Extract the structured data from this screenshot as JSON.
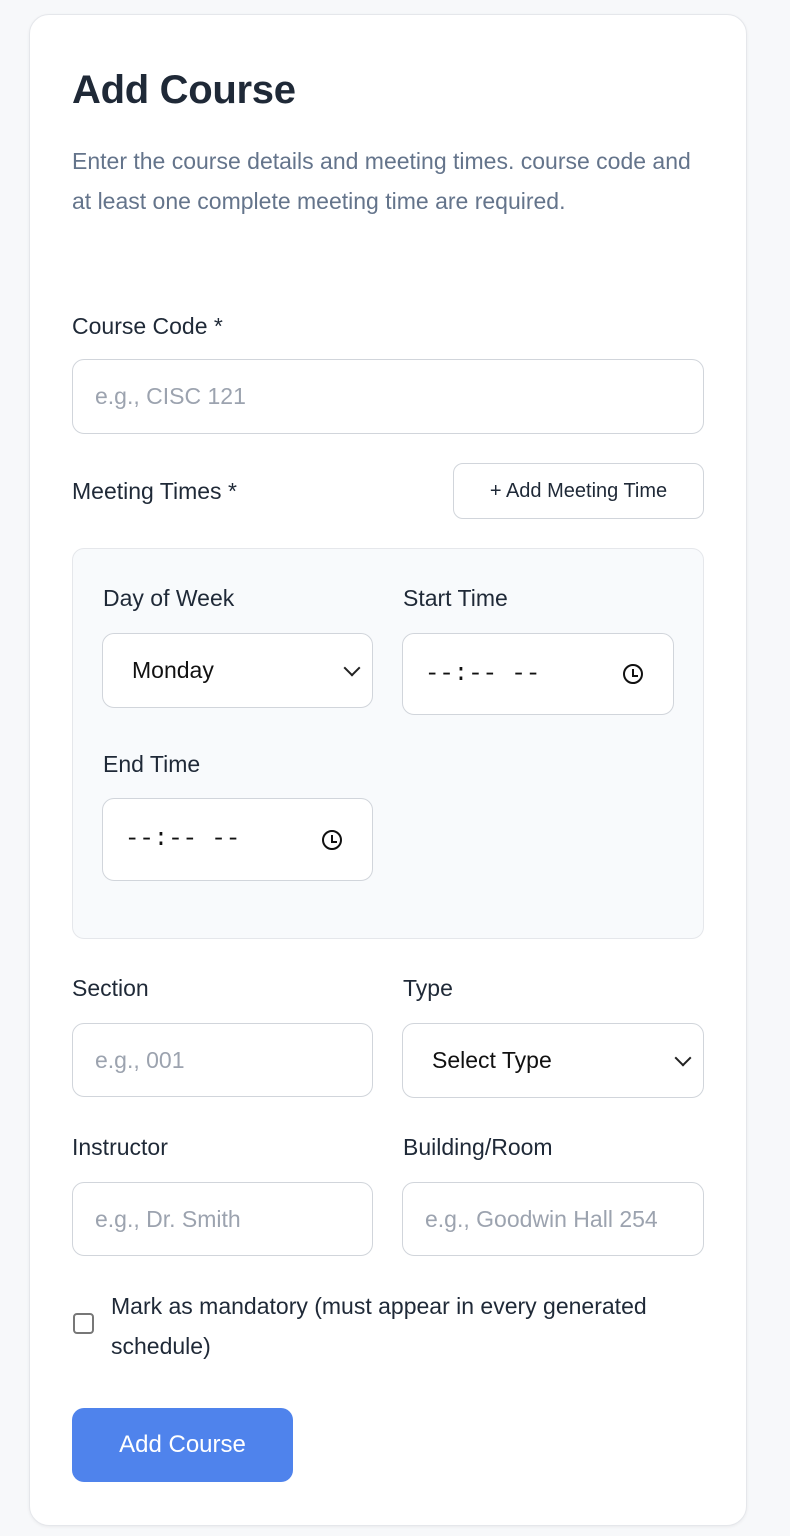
{
  "title": "Add Course",
  "description": "Enter the course details and meeting times. course code and at least one complete meeting time are required.",
  "course_code": {
    "label": "Course Code *",
    "placeholder": "e.g., CISC 121",
    "value": ""
  },
  "meeting_times": {
    "label": "Meeting Times *",
    "add_button": "+ Add Meeting Time",
    "entries": [
      {
        "day_label": "Day of Week",
        "day_value": "Monday",
        "start_label": "Start Time",
        "start_value": "--:-- --",
        "end_label": "End Time",
        "end_value": "--:-- --"
      }
    ]
  },
  "section": {
    "label": "Section",
    "placeholder": "e.g., 001"
  },
  "type": {
    "label": "Type",
    "value": "Select Type"
  },
  "instructor": {
    "label": "Instructor",
    "placeholder": "e.g., Dr. Smith"
  },
  "building": {
    "label": "Building/Room",
    "placeholder": "e.g., Goodwin Hall 254"
  },
  "mandatory": {
    "label": "Mark as mandatory (must appear in every generated schedule)",
    "checked": false
  },
  "submit_label": "Add Course",
  "colors": {
    "primary": "#4f83ec",
    "text": "#1f2937",
    "muted": "#64748b"
  }
}
